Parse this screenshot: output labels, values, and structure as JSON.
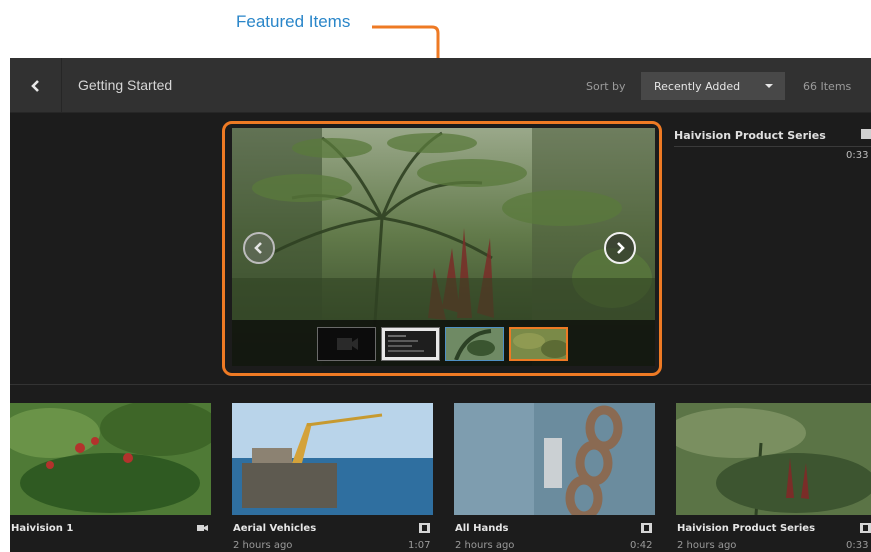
{
  "annotation": {
    "label": "Featured Items",
    "color": "#2a86c9",
    "highlight_color": "#ee7a24"
  },
  "header": {
    "back_icon": "chevron-left-icon",
    "title": "Getting Started",
    "sort_label": "Sort by",
    "sort_value": "Recently Added",
    "item_count": "66 Items"
  },
  "featured": {
    "prev_icon": "chevron-left-circle-icon",
    "next_icon": "chevron-right-circle-icon",
    "thumbnails": [
      "camera-thumb",
      "screen-thumb",
      "fern-thumb",
      "jungle-thumb"
    ],
    "selected_thumb_index": 3
  },
  "side_item": {
    "title": "Haivision Product Series",
    "duration": "0:33",
    "icon": "media-icon"
  },
  "cards": [
    {
      "title": "Haivision 1",
      "age": "",
      "duration": "",
      "icon": "camera-icon"
    },
    {
      "title": "Aerial Vehicles",
      "age": "2 hours ago",
      "duration": "1:07",
      "icon": "media-icon"
    },
    {
      "title": "All Hands",
      "age": "2 hours ago",
      "duration": "0:42",
      "icon": "media-icon"
    },
    {
      "title": "Haivision Product Series",
      "age": "2 hours ago",
      "duration": "0:33",
      "icon": "media-icon"
    }
  ]
}
